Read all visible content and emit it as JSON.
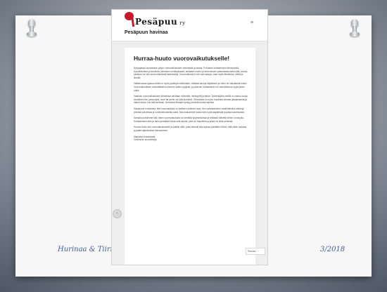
{
  "site": {
    "logo_text": "Pesäpuu",
    "logo_suffix": "ry",
    "title": "Pesäpuun havinaa"
  },
  "header": {
    "menu_icon": "≡"
  },
  "post": {
    "title": "Hurraa-huuto vuorovaikutukselle!",
    "paragraphs": [
      "Nykyajassa korostetaan paljon vuorovaikutuksen merkitystä ja laatua. Puhutaan kohtaamisen tärkeydestä, kuuntelemisen ja kuulluksi tulemisen merkityksestä, erilaisten kuvien ja kertomusten jakamisesta sekä siitä, kuinka jokainen voi olla oman elämänsä asiantuntija. Vuorovaikutus ei ole vain sanoja, vaan myös läsnäoloa, eleitä ja ilmeitä.",
      "Vallitsevassa ajassa meillä on hyvä pysähtyä miettimään, millaisia sanoja käytämme ja miten ne vaikuttavat toisiin. Vuorovaikutuksen ammattilaisina olemme kaikki oppijoita, ja jokainen kohtaaminen on mahdollisuus oppia jotain uutta.",
      "Vaativan vuorovaikutuksen tilanteissa tarvitaan rohkeutta, herkkyyttä ja taitoa. Työntekijöinä meillä on vastuu luoda turvallinen tila, jossa lapsi, nuori tai perhe voi tulla kuulluksi. Olennaista on myös huolehtia omasta jaksamisesta ja hakea tukea, kun sitä tarvitaan. Arvostava ilmapiiri syntyy pienistä teoista arjessa.",
      "Haluamme muistuttaa, että vuorovaikutus on kaikkien yhteinen asia. Sen vahvistaminen vaatii tietoisia valintoja, yhteistä pohdintaa ja rohkeutta kokeilla uutta. Siksi haluamme tuoda esiin hyviä käytäntöjä ja jakaa kokemuksia.",
      "Samalla pohdimme sitä, miten vuorovaikutusta voi kehittää työyhteisöissä ja millaisia välineitä siihen on tarjolla. Kohtaamisen taito ja halu ymmärtää toista ovat asioita, joita voi harjoitella ja joista voi iloita yhdessä.",
      "Hurraa-huuto siis vuorovaikutukselle ja kaikille niille, jotka tekevät sitä arjessa päivittäin! Kiitos, että olette mukana ja jaatte ajatuksianne kanssamme."
    ],
    "signoff_name": "Marjukka Koskenlaita",
    "signoff_role": "Viestinnän suunnittelija"
  },
  "signatures": {
    "left": "Hurinaa & Tiiri",
    "right": "3/2018"
  },
  "nav": {
    "prev_icon": "‹",
    "follow_label": "Seuraa ···"
  }
}
